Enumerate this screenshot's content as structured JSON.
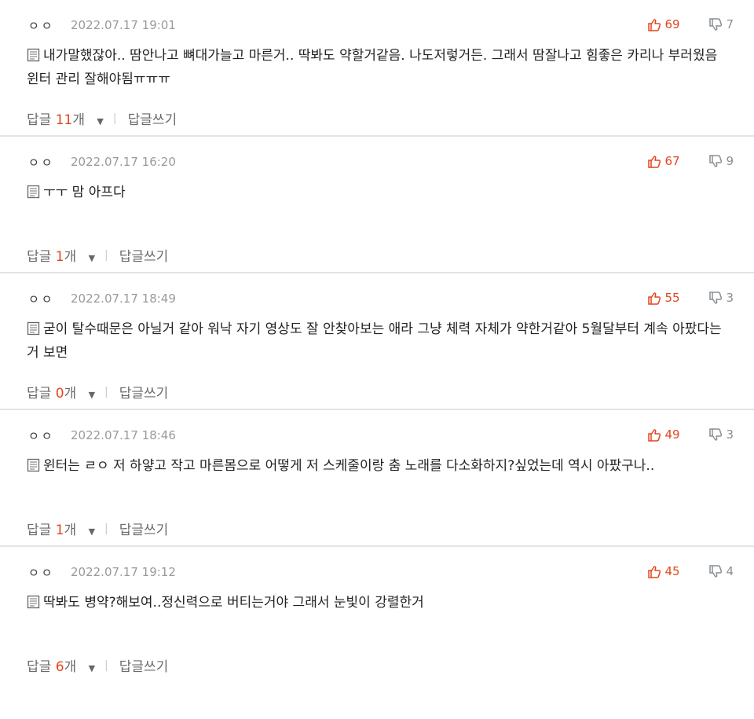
{
  "comments": [
    {
      "nick": "ㅇㅇ",
      "date": "2022.07.17 19:01",
      "up": "69",
      "down": "7",
      "lines": [
        "내가말했잖아.. 땀안나고 뼈대가늘고 마른거.. 딱봐도 약할거같음. 나도저렇거든. 그래서 땀잘나고 힘좋은 카리나 부러웠음",
        "윈터 관리 잘해야됨ㅠㅠㅠ"
      ],
      "reply_label": "답글",
      "reply_count": "11",
      "reply_unit": "개",
      "write_label": "답글쓰기"
    },
    {
      "nick": "ㅇㅇ",
      "date": "2022.07.17 16:20",
      "up": "67",
      "down": "9",
      "lines": [
        "ㅜㅜ 맘 아프다"
      ],
      "reply_label": "답글",
      "reply_count": "1",
      "reply_unit": "개",
      "write_label": "답글쓰기"
    },
    {
      "nick": "ㅇㅇ",
      "date": "2022.07.17 18:49",
      "up": "55",
      "down": "3",
      "lines": [
        "굳이 탈수때문은 아닐거 같아 워낙 자기 영상도 잘 안찾아보는 애라 그냥 체력 자체가 약한거같아 5월달부터 계속 아팠다는",
        "거 보면"
      ],
      "reply_label": "답글",
      "reply_count": "0",
      "reply_unit": "개",
      "write_label": "답글쓰기"
    },
    {
      "nick": "ㅇㅇ",
      "date": "2022.07.17 18:46",
      "up": "49",
      "down": "3",
      "lines": [
        "윈터는 ㄹㅇ 저 하얗고 작고 마른몸으로 어떻게 저 스케줄이랑 춤 노래를 다소화하지?싶었는데 역시 아팠구나.."
      ],
      "reply_label": "답글",
      "reply_count": "1",
      "reply_unit": "개",
      "write_label": "답글쓰기"
    },
    {
      "nick": "ㅇㅇ",
      "date": "2022.07.17 19:12",
      "up": "45",
      "down": "4",
      "lines": [
        "딱봐도 병약?해보여..정신력으로 버티는거야 그래서 눈빛이 강렬한거"
      ],
      "reply_label": "답글",
      "reply_count": "6",
      "reply_unit": "개",
      "write_label": "답글쓰기"
    }
  ],
  "icons": {
    "memo": "memo-icon",
    "thumbs_up": "thumbs-up-icon",
    "thumbs_down": "thumbs-down-icon",
    "caret": "caret-down-icon"
  },
  "colors": {
    "accent": "#e2461b",
    "muted": "#9a9a9a",
    "divider": "#e4e4e4"
  }
}
